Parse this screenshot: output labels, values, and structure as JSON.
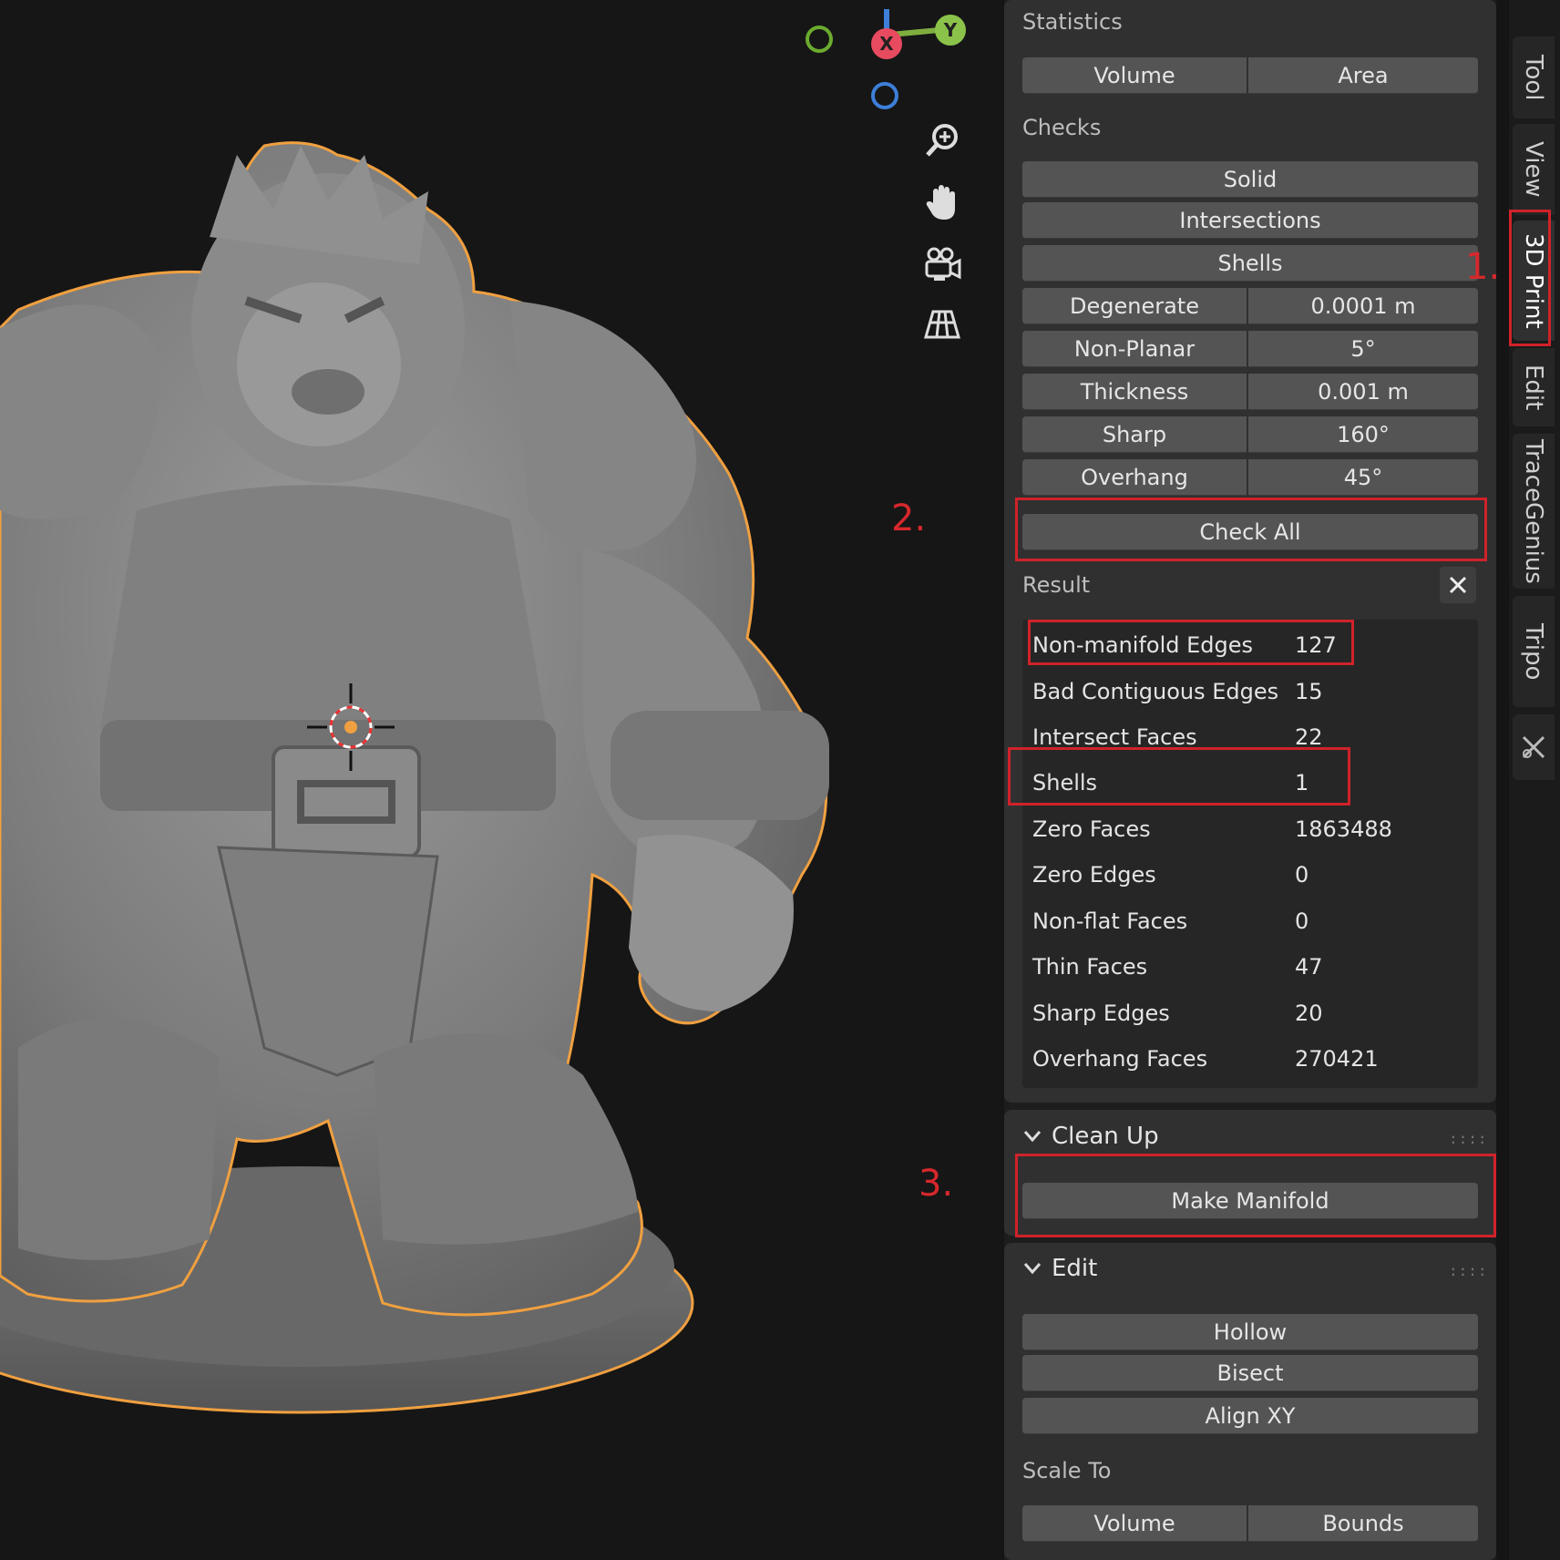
{
  "annotations": [
    "1.",
    "2.",
    "3."
  ],
  "gizmo": {
    "x_label": "X",
    "y_label": "Y",
    "colors": {
      "x": "#e84a5f",
      "y": "#8bc34a",
      "z": "#3d7fd9"
    }
  },
  "viewport_tools": [
    "zoom-icon",
    "pan-icon",
    "camera-icon",
    "perspective-grid-icon"
  ],
  "panel": {
    "statistics": {
      "title": "Statistics",
      "volume": "Volume",
      "area": "Area"
    },
    "checks": {
      "title": "Checks",
      "solid": "Solid",
      "intersections": "Intersections",
      "shells": "Shells",
      "rows": [
        {
          "label": "Degenerate",
          "value": "0.0001 m"
        },
        {
          "label": "Non-Planar",
          "value": "5°"
        },
        {
          "label": "Thickness",
          "value": "0.001 m"
        },
        {
          "label": "Sharp",
          "value": "160°"
        },
        {
          "label": "Overhang",
          "value": "45°"
        }
      ],
      "check_all": "Check All"
    },
    "result": {
      "title": "Result",
      "rows": [
        {
          "label": "Non-manifold Edges",
          "value": "127"
        },
        {
          "label": "Bad Contiguous Edges",
          "value": "15"
        },
        {
          "label": "Intersect Faces",
          "value": "22"
        },
        {
          "label": "Shells",
          "value": "1"
        },
        {
          "label": "Zero Faces",
          "value": "1863488"
        },
        {
          "label": "Zero Edges",
          "value": "0"
        },
        {
          "label": "Non-flat Faces",
          "value": "0"
        },
        {
          "label": "Thin Faces",
          "value": "47"
        },
        {
          "label": "Sharp Edges",
          "value": "20"
        },
        {
          "label": "Overhang Faces",
          "value": "270421"
        }
      ]
    },
    "cleanup": {
      "title": "Clean Up",
      "make_manifold": "Make Manifold"
    },
    "edit": {
      "title": "Edit",
      "hollow": "Hollow",
      "bisect": "Bisect",
      "align_xy": "Align XY"
    },
    "scale_to": {
      "title": "Scale To",
      "volume": "Volume",
      "bounds": "Bounds"
    }
  },
  "tabs": [
    "Tool",
    "View",
    "3D Print",
    "Edit",
    "TraceGenius",
    "Tripo"
  ],
  "accent_colors": {
    "highlight": "#d0222a",
    "selection_outline": "#f0a040"
  }
}
